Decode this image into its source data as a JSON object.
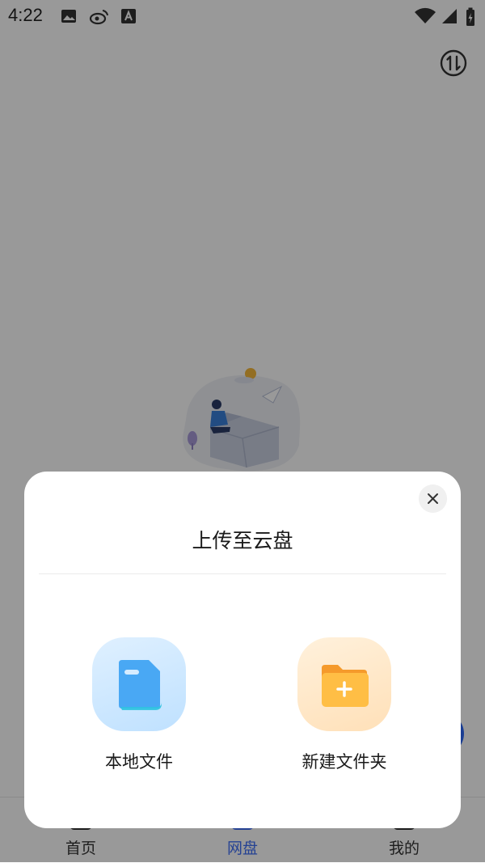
{
  "status_bar": {
    "time": "4:22",
    "icons": [
      "image-icon",
      "weibo-icon",
      "font-a-icon"
    ],
    "right_icons": [
      "wifi-icon",
      "signal-icon",
      "battery-charging-icon"
    ]
  },
  "header": {
    "action_icon": "transfer-icon"
  },
  "bottom_nav": {
    "items": [
      {
        "label": "首页",
        "active": false
      },
      {
        "label": "网盘",
        "active": true
      },
      {
        "label": "我的",
        "active": false
      }
    ]
  },
  "upload_sheet": {
    "title": "上传至云盘",
    "options": [
      {
        "label": "本地文件",
        "icon": "document-icon"
      },
      {
        "label": "新建文件夹",
        "icon": "new-folder-icon"
      }
    ]
  },
  "colors": {
    "accent": "#3f6ef6",
    "overlay": "rgba(0,0,0,0.40)"
  }
}
